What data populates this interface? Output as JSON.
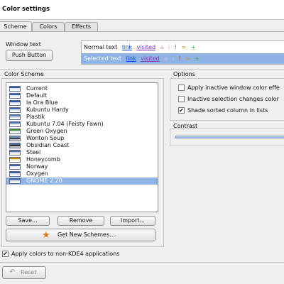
{
  "window": {
    "title": "Color settings"
  },
  "tabs": [
    {
      "label": "Scheme",
      "active": true
    },
    {
      "label": "Colors",
      "active": false
    },
    {
      "label": "Effects",
      "active": false
    }
  ],
  "window_text": {
    "label": "Window text",
    "push_button": "Push Button",
    "normal": {
      "text": "Normal text",
      "link": "link",
      "visited": "visited",
      "marks": [
        "a",
        "i",
        "!",
        "=",
        "+"
      ]
    },
    "selected": {
      "text": "Selected text",
      "link": "link",
      "visited": "visited",
      "marks": [
        "a",
        "i",
        "!",
        "=",
        "+"
      ]
    }
  },
  "color_scheme": {
    "title": "Color Scheme",
    "items": [
      {
        "label": "Current",
        "icon_colors": [
          "#dfe6f3",
          "#3a5fa0",
          "#ffffff"
        ]
      },
      {
        "label": "Default",
        "icon_colors": [
          "#dfe6f3",
          "#3a5fa0",
          "#ffffff"
        ]
      },
      {
        "label": "la Ora Blue",
        "icon_colors": [
          "#dde4f0",
          "#2f56a8",
          "#ffffff"
        ]
      },
      {
        "label": "Kubuntu Hardy",
        "icon_colors": [
          "#e4e8ef",
          "#3f6cb0",
          "#ffffff"
        ]
      },
      {
        "label": "Plastik",
        "icon_colors": [
          "#e0e0e0",
          "#5477b4",
          "#ffffff"
        ]
      },
      {
        "label": "Kubuntu 7.04 (Feisty Fawn)",
        "icon_colors": [
          "#e2e6ec",
          "#4a6fa8",
          "#ffffff"
        ]
      },
      {
        "label": "Green Oxygen",
        "icon_colors": [
          "#dde8dc",
          "#3e8a3a",
          "#ffffff"
        ]
      },
      {
        "label": "Wonton Soup",
        "icon_colors": [
          "#3b3f48",
          "#6f8fbf",
          "#cfcfcf"
        ]
      },
      {
        "label": "Obsidian Coast",
        "icon_colors": [
          "#262a30",
          "#506ea0",
          "#c8c8c8"
        ]
      },
      {
        "label": "Steel",
        "icon_colors": [
          "#d8dce2",
          "#5070a0",
          "#ffffff"
        ]
      },
      {
        "label": "Honeycomb",
        "icon_colors": [
          "#f1e7b6",
          "#c28f10",
          "#ffffff"
        ]
      },
      {
        "label": "Norway",
        "icon_colors": [
          "#e6e8ec",
          "#3b62a8",
          "#ffffff"
        ]
      },
      {
        "label": "Oxygen",
        "icon_colors": [
          "#e2e6ee",
          "#3a5fa0",
          "#ffffff"
        ]
      },
      {
        "label": "GNOME 2.20",
        "icon_colors": [
          "#e9e6e1",
          "#4a78c4",
          "#ffffff"
        ],
        "selected": true
      }
    ],
    "buttons": {
      "save": "Save...",
      "remove": "Remove",
      "import": "Import...",
      "get_new": "Get New Schemes..."
    }
  },
  "options": {
    "title": "Options",
    "items": [
      {
        "label": "Apply inactive window color effe",
        "checked": false
      },
      {
        "label": "Inactive selection changes color",
        "checked": false
      },
      {
        "label": "Shade sorted column in lists",
        "checked": true
      }
    ]
  },
  "contrast": {
    "title": "Contrast"
  },
  "apply_non_kde": {
    "label": "Apply colors to non-KDE4 applications",
    "checked": true
  },
  "footer": {
    "reset": "Reset"
  },
  "colors": {
    "selection": "#8db2e3",
    "link": "#0044dd",
    "visited": "#8a2fb8",
    "selected_bg": "#8db2e3"
  }
}
